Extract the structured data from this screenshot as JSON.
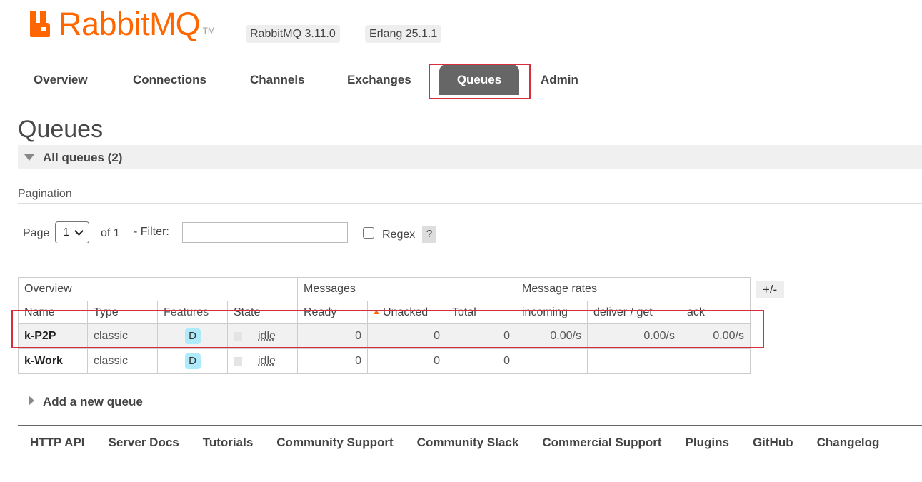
{
  "header": {
    "logo_text_rabbit": "Rabbit",
    "logo_text_mq": "MQ",
    "logo_tm": "TM",
    "rabbitmq_version": "RabbitMQ 3.11.0",
    "erlang_version": "Erlang 25.1.1",
    "brand_color": "#ff6600"
  },
  "nav": {
    "tabs": [
      {
        "label": "Overview"
      },
      {
        "label": "Connections"
      },
      {
        "label": "Channels"
      },
      {
        "label": "Exchanges"
      },
      {
        "label": "Queues"
      },
      {
        "label": "Admin"
      }
    ],
    "active": "Queues"
  },
  "page": {
    "title": "Queues",
    "section_label": "All queues (2)"
  },
  "pagination": {
    "heading": "Pagination",
    "page_label": "Page",
    "page_value": "1",
    "of_label": "of 1",
    "filter_label": "- Filter:",
    "filter_value": "",
    "regex_label": "Regex",
    "help_label": "?"
  },
  "table": {
    "groups": [
      "Overview",
      "Messages",
      "Message rates"
    ],
    "columns": [
      "Name",
      "Type",
      "Features",
      "State",
      "Ready",
      "Unacked",
      "Total",
      "incoming",
      "deliver / get",
      "ack"
    ],
    "toggle_label": "+/-",
    "rows": [
      {
        "name": "k-P2P",
        "type": "classic",
        "feature": "D",
        "state": "idle",
        "ready": "0",
        "unacked": "0",
        "total": "0",
        "incoming": "0.00/s",
        "deliver_get": "0.00/s",
        "ack": "0.00/s"
      },
      {
        "name": "k-Work",
        "type": "classic",
        "feature": "D",
        "state": "idle",
        "ready": "0",
        "unacked": "0",
        "total": "0",
        "incoming": "",
        "deliver_get": "",
        "ack": ""
      }
    ]
  },
  "add_queue_label": "Add a new queue",
  "footer": {
    "links": [
      "HTTP API",
      "Server Docs",
      "Tutorials",
      "Community Support",
      "Community Slack",
      "Commercial Support",
      "Plugins",
      "GitHub",
      "Changelog"
    ]
  },
  "annotation_color": "#d32f3c"
}
